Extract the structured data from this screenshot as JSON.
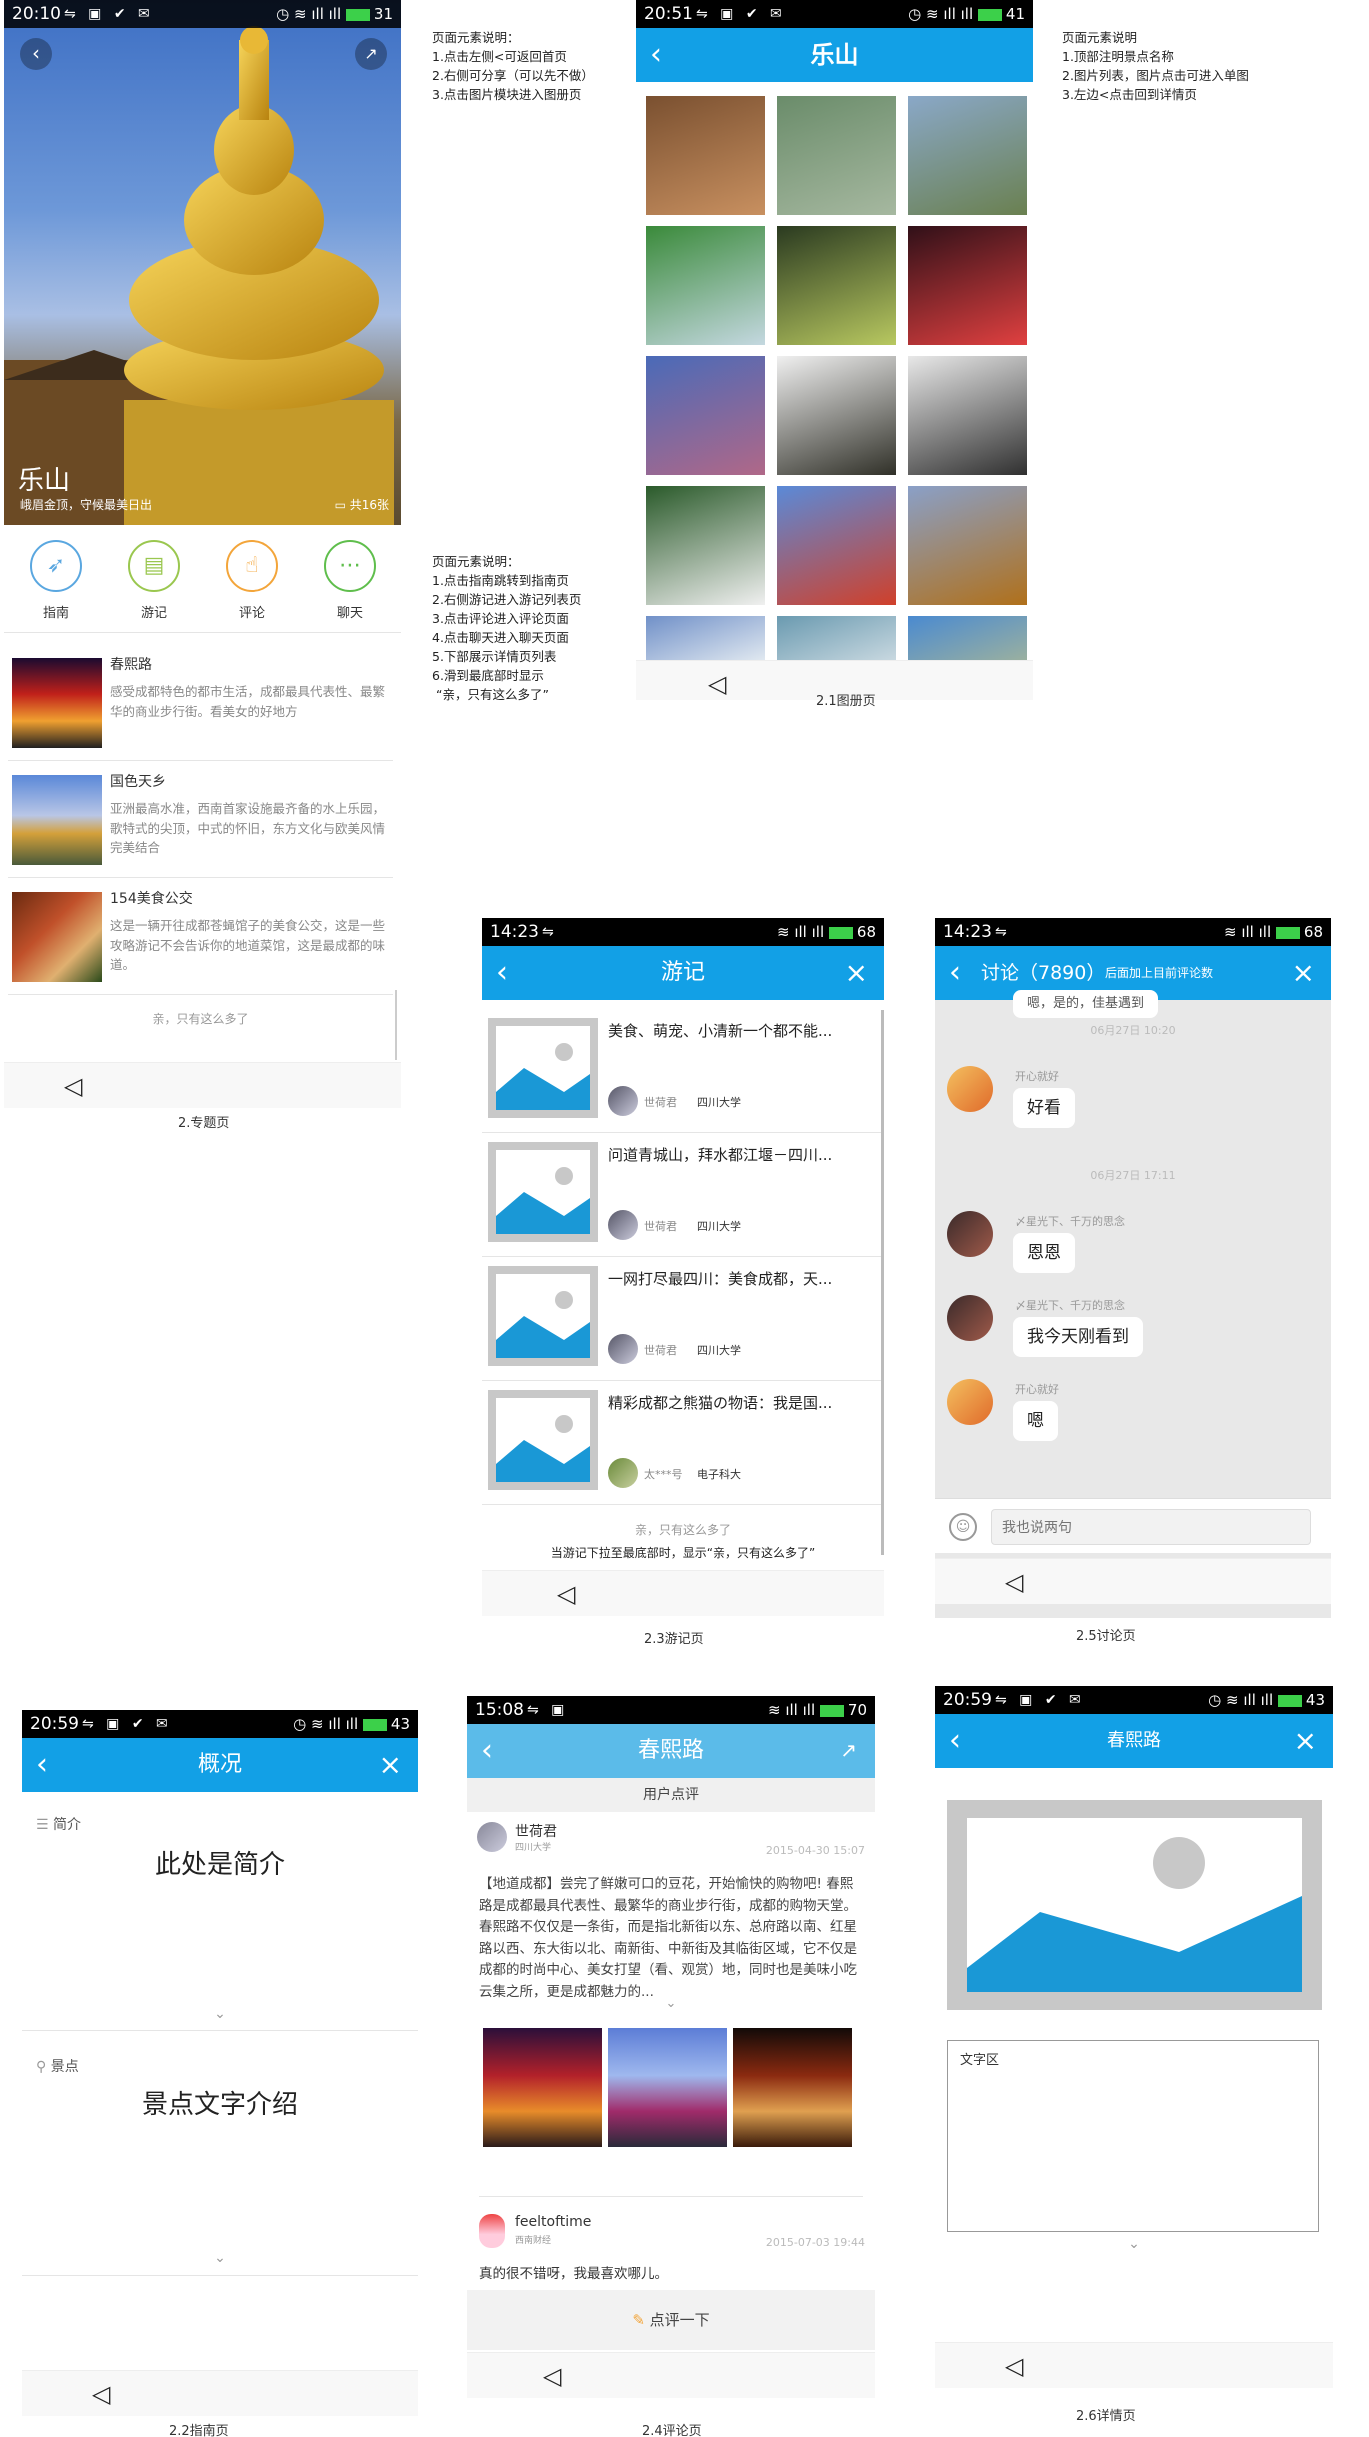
{
  "p1": {
    "time": "20:10",
    "battery": "31",
    "title": "乐山",
    "subtitle": "峨眉金顶，守候最美日出",
    "count": "共16张",
    "menu": [
      {
        "label": "指南",
        "icon": "compass-icon",
        "color": "#5aa7e0"
      },
      {
        "label": "游记",
        "icon": "book-icon",
        "color": "#9ac74f"
      },
      {
        "label": "评论",
        "icon": "thumb-icon",
        "color": "#f3a53a"
      },
      {
        "label": "聊天",
        "icon": "chat-icon",
        "color": "#5fbe4c"
      }
    ],
    "items": [
      {
        "title": "春熙路",
        "desc": "感受成都特色的都市生活，成都最具代表性、最繁华的商业步行街。看美女的好地方"
      },
      {
        "title": "国色天乡",
        "desc": "亚洲最高水准，西南首家设施最齐备的水上乐园，歌特式的尖顶，中式的怀旧，东方文化与欧美风情完美结合"
      },
      {
        "title": "154美食公交",
        "desc": "这是一辆开往成都苍蝇馆子的美食公交，这是一些攻略游记不会告诉你的地道菜馆，这是最成都的味道。"
      }
    ],
    "end_text": "亲，只有这么多了",
    "caption": "2.专题页",
    "note": "页面元素说明：\n1.点击左侧<可返回首页\n2.右侧可分享（可以先不做）\n3.点击图片模块进入图册页",
    "note2": "页面元素说明：\n1.点击指南跳转到指南页\n2.右侧游记进入游记列表页\n3.点击评论进入评论页面\n4.点击聊天进入聊天页面\n5.下部展示详情页列表\n6.滑到最底部时显示\n “亲，只有这么多了”"
  },
  "p21": {
    "time": "20:51",
    "battery": "41",
    "title": "乐山",
    "caption": "2.1图册页",
    "note": "页面元素说明\n1.顶部注明景点名称\n2.图片列表，图片点击可进入单图\n3.左边<点击回到详情页"
  },
  "p23": {
    "time": "14:23",
    "battery": "68",
    "title": "游记",
    "caption": "2.3游记页",
    "end_text": "亲，只有这么多了",
    "footer": "当游记下拉至最底部时，显示“亲，只有这么多了”",
    "items": [
      {
        "title": "美食、萌宠、小清新一个都不能...",
        "author": "世荷君",
        "school": "四川大学"
      },
      {
        "title": "问道青城山，拜水都江堰－四川...",
        "author": "世荷君",
        "school": "四川大学"
      },
      {
        "title": "一网打尽最四川：美食成都，天...",
        "author": "世荷君",
        "school": "四川大学"
      },
      {
        "title": "精彩成都之熊猫の物语：我是国...",
        "author": "太***号",
        "school": "电子科大"
      }
    ]
  },
  "p25": {
    "time": "14:23",
    "battery": "68",
    "title": "讨论（7890）",
    "hint": "后面加上目前评论数",
    "caption": "2.5讨论页",
    "top_msg": "嗯，是的，佳基遇到",
    "input_ph": "我也说两句",
    "msgs": [
      {
        "type": "time",
        "text": "06月27日 10:20"
      },
      {
        "type": "msg",
        "name": "开心就好",
        "text": "好看"
      },
      {
        "type": "time",
        "text": "06月27日 17:11"
      },
      {
        "type": "msg",
        "name": "〆星光下、千万的思念",
        "text": "恩恩"
      },
      {
        "type": "msg",
        "name": "〆星光下、千万的思念",
        "text": "我今天刚看到"
      },
      {
        "type": "msg",
        "name": "开心就好",
        "text": "嗯"
      }
    ]
  },
  "p22": {
    "time": "20:59",
    "battery": "43",
    "title": "概况",
    "caption": "2.2指南页",
    "sec1": "简介",
    "sec1_body": "此处是简介",
    "sec2": "景点",
    "sec2_body": "景点文字介绍"
  },
  "p24": {
    "time": "15:08",
    "battery": "70",
    "title": "春熙路",
    "caption": "2.4评论页",
    "tab": "用户点评",
    "c1": {
      "name": "世荷君",
      "school": "四川大学",
      "date": "2015-04-30 15:07",
      "text": "【地道成都】尝完了鲜嫩可口的豆花，开始愉快的购物吧! 春熙路是成都最具代表性、最繁华的商业步行街，成都的购物天堂。春熙路不仅仅是一条街，而是指北新街以东、总府路以南、红星路以西、东大街以北、南新街、中新街及其临街区域，它不仅是成都的时尚中心、美女打望（看、观赏）地，同时也是美味小吃云集之所，更是成都魅力的..."
    },
    "c2": {
      "name": "feeltoftime",
      "school": "西南财经",
      "date": "2015-07-03 19:44",
      "text": "真的很不错呀，我最喜欢哪儿。"
    },
    "btn": "点评一下"
  },
  "p26": {
    "time": "20:59",
    "battery": "43",
    "title": "春熙路",
    "caption": "2.6详情页",
    "text_area": "文字区"
  }
}
